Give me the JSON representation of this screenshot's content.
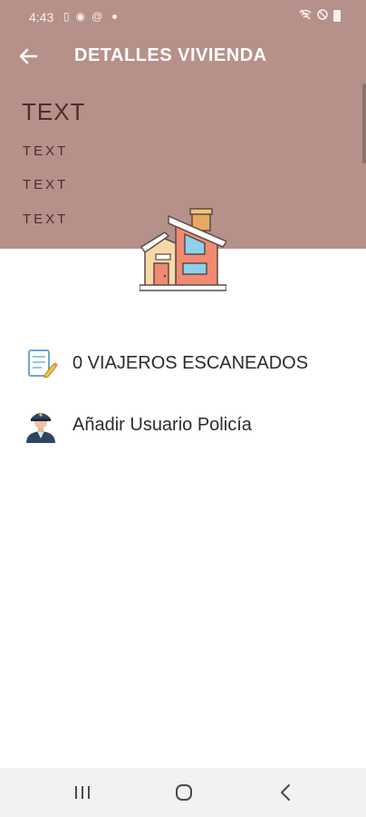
{
  "status_bar": {
    "time": "4:43",
    "icons_left": [
      "sim-icon",
      "notification-icon",
      "at-icon",
      "dot"
    ],
    "icons_right": [
      "wifi-off-icon",
      "dnd-icon",
      "battery-icon"
    ]
  },
  "toolbar": {
    "back_icon": "arrow-left-icon",
    "title": "DETALLES VIVIENDA"
  },
  "header": {
    "heading": "TEXT",
    "lines": [
      "TEXT",
      "TEXT",
      "TEXT"
    ],
    "image": "house-icon"
  },
  "list": [
    {
      "icon": "notepad-icon",
      "label": "0 VIAJEROS ESCANEADOS"
    },
    {
      "icon": "police-officer-icon",
      "label": "Añadir Usuario Policía"
    }
  ],
  "colors": {
    "header_bg": "#b6918a",
    "text_dark": "#4a2f2b",
    "navbar_bg": "#f2f1f3"
  }
}
